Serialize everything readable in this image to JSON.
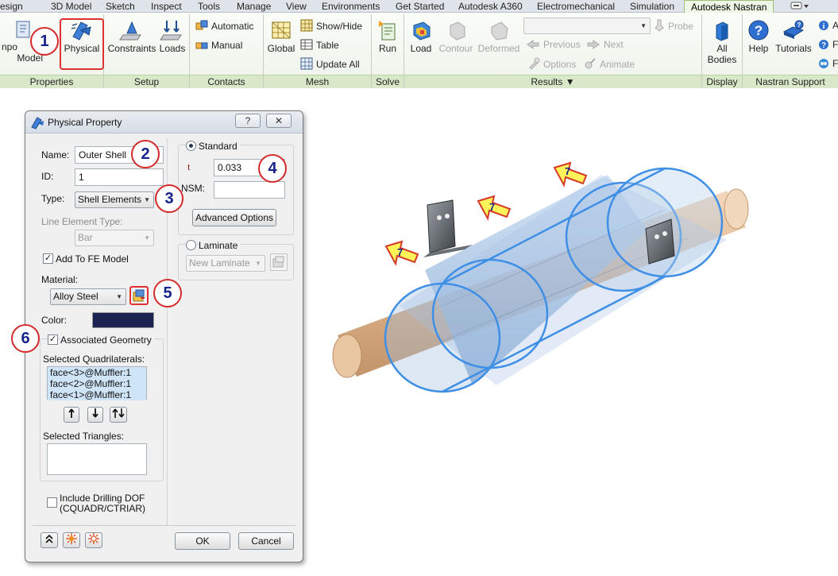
{
  "ribbon_tabs": [
    "esign",
    "3D Model",
    "Sketch",
    "Inspect",
    "Tools",
    "Manage",
    "View",
    "Environments",
    "Get Started",
    "Autodesk A360",
    "Electromechanical",
    "Simulation",
    "Autodesk Nastran"
  ],
  "ribbon_tabs_active": "Autodesk Nastran",
  "ribbon": {
    "import_line1": "npo",
    "import_line2": "Model",
    "physical": "Physical",
    "constraints": "Constraints",
    "loads": "Loads",
    "automatic": "Automatic",
    "manual": "Manual",
    "global": "Global",
    "show_hide": "Show/Hide",
    "table": "Table",
    "update_all": "Update  All",
    "run": "Run",
    "load": "Load",
    "contour": "Contour",
    "deformed": "Deformed",
    "probe": "Probe",
    "previous": "Previous",
    "next": "Next",
    "options": "Options",
    "animate": "Animate",
    "all_line1": "All",
    "all_line2": "Bodies",
    "help": "Help",
    "tutorials": "Tutorials",
    "support_a": "A",
    "support_f1": "F",
    "support_f2": "F"
  },
  "groups": {
    "properties": "Properties",
    "setup": "Setup",
    "contacts": "Contacts",
    "mesh": "Mesh",
    "solve": "Solve",
    "results": "Results ▼",
    "display": "Display",
    "nastran_support": "Nastran Support"
  },
  "dialog": {
    "title": "Physical Property",
    "help_btn": "?",
    "close_btn": "✕",
    "name_label": "Name:",
    "name_value": "Outer Shell",
    "id_label": "ID:",
    "id_value": "1",
    "type_label": "Type:",
    "type_value": "Shell Elements",
    "line_elem_label": "Line Element Type:",
    "line_elem_value": "Bar",
    "add_fe": "Add To FE Model",
    "material_label": "Material:",
    "material_value": "Alloy Steel",
    "color_label": "Color:",
    "color_value": "#1c2350",
    "assoc_geom": "Associated Geometry",
    "sel_quads_label": "Selected Quadrilaterals:",
    "quads": [
      "face<3>@Muffler:1",
      "face<2>@Muffler:1",
      "face<1>@Muffler:1"
    ],
    "sel_tris_label": "Selected Triangles:",
    "drilling_line1": "Include Drilling DOF",
    "drilling_line2": "(CQUADR/CTRIAR)",
    "standard": "Standard",
    "t_label": "t",
    "t_value": "0.033",
    "nsm_label": "NSM:",
    "advanced": "Advanced Options",
    "laminate": "Laminate",
    "laminate_value": "New Laminate",
    "ok": "OK",
    "cancel": "Cancel"
  },
  "callouts": {
    "c1": "1",
    "c2": "2",
    "c3": "3",
    "c4": "4",
    "c5": "5",
    "c6": "6",
    "arrow1": "7",
    "arrow2": "7",
    "arrow3": "7"
  }
}
